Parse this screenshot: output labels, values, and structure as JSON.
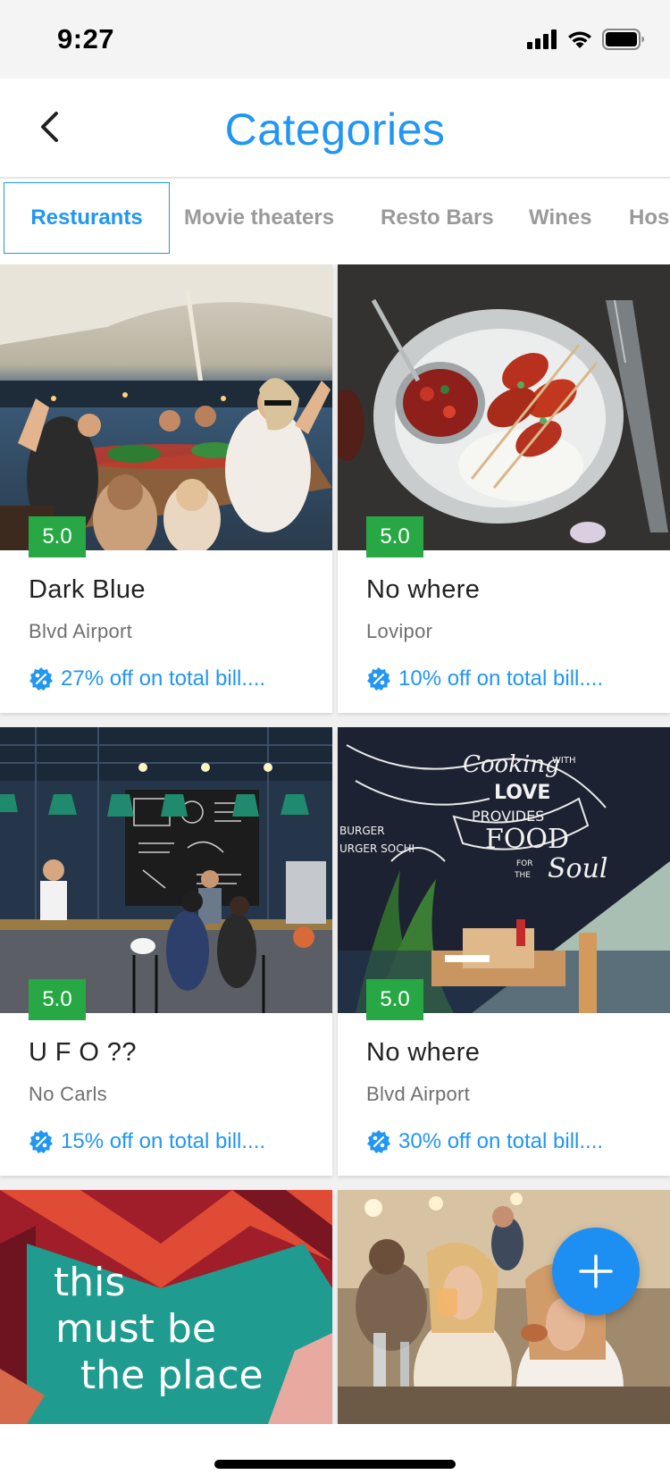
{
  "status_bar": {
    "time": "9:27"
  },
  "header": {
    "title": "Categories",
    "back_icon": "chevron-left-icon"
  },
  "tabs": [
    {
      "label": "Resturants",
      "active": true
    },
    {
      "label": "Movie theaters",
      "active": false
    },
    {
      "label": "Resto Bars",
      "active": false
    },
    {
      "label": "Wines",
      "active": false
    },
    {
      "label": "Hos",
      "active": false
    }
  ],
  "cards": [
    {
      "rating": "5.0",
      "name": "Dark Blue",
      "location": "Blvd Airport",
      "offer": "27% off on total bill...."
    },
    {
      "rating": "5.0",
      "name": "No where",
      "location": "Lovipor",
      "offer": "10% off on total bill...."
    },
    {
      "rating": "5.0",
      "name": "U F O ??",
      "location": "No Carls",
      "offer": "15% off on total bill...."
    },
    {
      "rating": "5.0",
      "name": "No where",
      "location": "Blvd Airport",
      "offer": "30% off on total bill...."
    }
  ],
  "image_text": {
    "neon_sign": [
      "this",
      "must be",
      "the place"
    ],
    "wall_art": [
      "Cooking",
      "WITH",
      "LOVE",
      "PROVIDES",
      "FOOD",
      "FOR",
      "THE",
      "Soul",
      "BURGER",
      "URGER SOCHI"
    ]
  },
  "fab": {
    "icon": "plus-icon"
  },
  "colors": {
    "accent": "#2196f3",
    "rating_badge": "#27a845",
    "tab_inactive": "#9a9a9a"
  }
}
